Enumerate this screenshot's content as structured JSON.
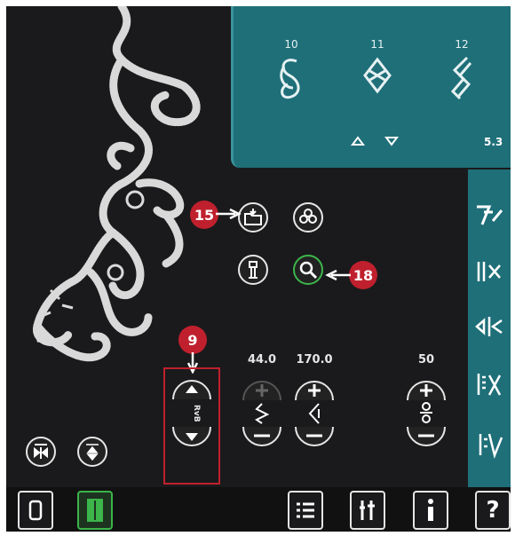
{
  "stitch_panel": {
    "stitches": [
      {
        "number": "10",
        "icon": "loop-stitch-icon"
      },
      {
        "number": "11",
        "icon": "diamond-loop-stitch-icon"
      },
      {
        "number": "12",
        "icon": "zigzag-chain-stitch-icon"
      }
    ],
    "value": "5.3",
    "nav_icons": [
      "scroll-up-icon",
      "scroll-down-icon"
    ]
  },
  "controls": {
    "width_value": "44.0",
    "length_value": "170.0",
    "density_value": "50"
  },
  "callouts": {
    "file_menu": "15",
    "zoom": "18",
    "reverse": "9"
  },
  "reverse_label": "RvB",
  "bottom_tabs": [
    "embroidery-edit-tab",
    "embroidery-stitch-out-tab",
    "selection-menu-tab",
    "settings-tab",
    "info-tab",
    "help-tab"
  ],
  "help_label": "?",
  "colors": {
    "accent": "#1f6f79",
    "active": "#3cb54a",
    "callout": "#c0202d"
  }
}
